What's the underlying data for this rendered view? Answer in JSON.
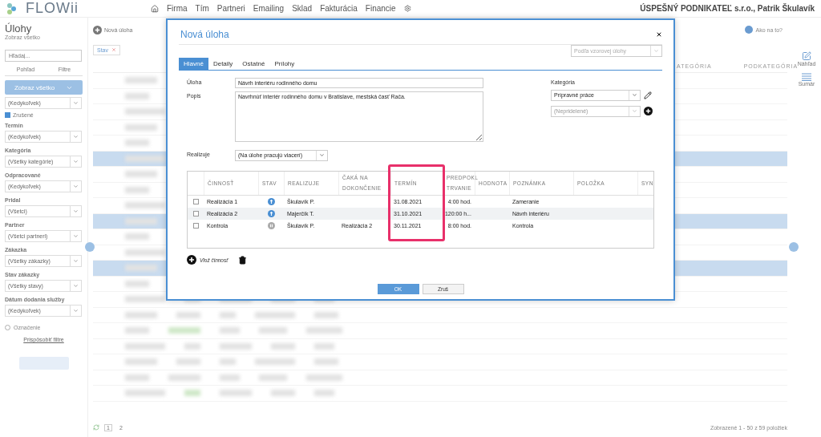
{
  "header": {
    "logo": "FLOWii",
    "nav": [
      "Firma",
      "Tím",
      "Partneri",
      "Emailing",
      "Sklad",
      "Fakturácia",
      "Financie"
    ],
    "company": "ÚSPEŠNÝ PODNIKATEĽ s.r.o., Patrik Škulavík"
  },
  "sidebar": {
    "title": "Úlohy",
    "subtitle": "Zobraz všetko",
    "search": {
      "placeholder": "Hľadaj..."
    },
    "view_tabs": [
      "Pohľad",
      "Filtre"
    ],
    "show_all_button": "Zobraz všetko",
    "filters": [
      {
        "kind": "select",
        "value": "(Kedykoľvek)"
      },
      {
        "kind": "checkbox",
        "label": "Zrušené",
        "checked": true
      },
      {
        "kind": "select",
        "label": "Termín",
        "value": "(Kedykoľvek)"
      },
      {
        "kind": "select",
        "label": "Kategória",
        "value": "(Všetky kategórie)"
      },
      {
        "kind": "select",
        "label": "Odpracované",
        "value": "(Kedykoľvek)"
      },
      {
        "kind": "select",
        "label": "Pridal",
        "value": "(Všetci)"
      },
      {
        "kind": "select",
        "label": "Partner",
        "value": "(Všetci partneri)"
      },
      {
        "kind": "select",
        "label": "Zákazka",
        "value": "(Všetky zákazky)"
      },
      {
        "kind": "select",
        "label": "Stav zákazky",
        "value": "(Všetky stavy)"
      },
      {
        "kind": "select",
        "label": "Dátum dodania služby",
        "value": "(Kedykoľvek)"
      }
    ],
    "marking": "Označenie",
    "customize_link": "Prispôsobiť filtre"
  },
  "toolbar": {
    "new_button": "Nová úloha",
    "help": "Ako na to?",
    "tag": "Stav"
  },
  "main_table": {
    "columns": [
      "ATEGÓRIA",
      "PODKATEGÓRIA"
    ],
    "rows": [
      {
        "selected": false
      },
      {
        "selected": false
      },
      {
        "selected": false
      },
      {
        "selected": false
      },
      {
        "selected": false
      },
      {
        "selected": true
      },
      {
        "selected": false
      },
      {
        "selected": false
      },
      {
        "selected": false
      },
      {
        "selected": true
      },
      {
        "selected": false
      },
      {
        "selected": false
      },
      {
        "selected": true
      },
      {
        "selected": false
      },
      {
        "selected": false
      },
      {
        "selected": false
      },
      {
        "selected": false
      },
      {
        "selected": false
      },
      {
        "selected": false
      },
      {
        "selected": false
      },
      {
        "selected": false
      }
    ],
    "pages": [
      {
        "label": "1",
        "selected": true
      },
      {
        "label": "2",
        "selected": false
      }
    ],
    "summary": "Zobrazené 1 - 50 z 59 položiek"
  },
  "right_bar": [
    "Náhľad",
    "Sumár"
  ],
  "dialog": {
    "title": "Nová úloha",
    "tabs": [
      {
        "label": "Hlavné",
        "selected": true
      },
      {
        "label": "Detaily",
        "selected": false
      },
      {
        "label": "Ostatné",
        "selected": false
      },
      {
        "label": "Prílohy",
        "selected": false
      }
    ],
    "template_select": {
      "placeholder": "Podľa vzorovej úlohy"
    },
    "task": {
      "label": "Úloha",
      "value": "Návrh interiéru rodinného domu"
    },
    "description": {
      "label": "Popis",
      "value": "Navrhnúť interiér rodinného domu v Bratislave, mestská časť Rača."
    },
    "assignee": {
      "label": "Realizuje",
      "value": "(Na úlohe pracujú viacerí)"
    },
    "category": {
      "label": "Kategória",
      "value": "Prípravné práce",
      "subcategory": "(Nepridelené)"
    },
    "activities": {
      "columns": [
        {
          "label": "ČINNOSŤ",
          "highlighted": false
        },
        {
          "label": "STAV",
          "highlighted": false
        },
        {
          "label": "REALIZUJE",
          "highlighted": false
        },
        {
          "label": "ČAKÁ NA DOKONČENIE",
          "highlighted": false
        },
        {
          "label": "TERMÍN",
          "highlighted": true
        },
        {
          "label": "PREDPOKL TRVANIE",
          "highlighted": false
        },
        {
          "label": "HODNOTA",
          "highlighted": false
        },
        {
          "label": "POZNÁMKA",
          "highlighted": false
        },
        {
          "label": "POLOŽKA",
          "highlighted": false
        },
        {
          "label": "SYN",
          "highlighted": false
        }
      ],
      "rows": [
        {
          "checked": false,
          "name": "Realizácia 1",
          "kind": "active",
          "assignee": "Škulavík P.",
          "due": "31.08.2021",
          "duration": "4:00 hod.",
          "note": "Zameranie"
        },
        {
          "checked": false,
          "name": "Realizácia 2",
          "kind": "active",
          "assignee": "Majerčík T.",
          "due": "31.10.2021",
          "duration": "120:00 h...",
          "note": "Návrh interiéru"
        },
        {
          "checked": false,
          "name": "Kontrola",
          "kind": "paused",
          "assignee": "Škulavík P.",
          "waits_for": "Realizácia 2",
          "due": "30.11.2021",
          "duration": "8:00 hod.",
          "note": "Kontrola"
        }
      ],
      "add_button": "Vlož činnosť"
    },
    "buttons": [
      "OK",
      "Zruš"
    ]
  }
}
